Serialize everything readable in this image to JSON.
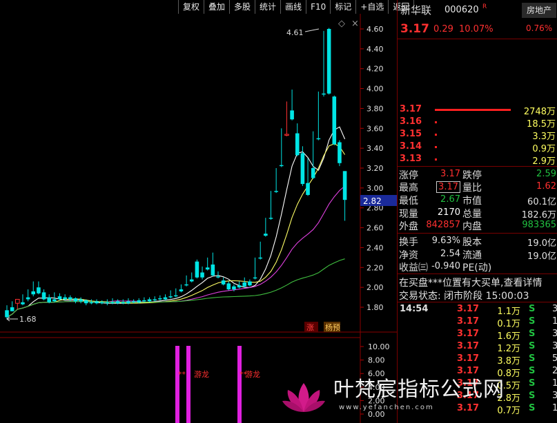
{
  "toolbar": [
    "复权",
    "叠加",
    "多股",
    "统计",
    "画线",
    "F10",
    "标记",
    "+自选",
    "返回"
  ],
  "colors": {
    "up": "#ff3030",
    "down": "#00e5e5",
    "ma5": "#ffffff",
    "ma10": "#ffff66",
    "ma20": "#e040e0",
    "ma60": "#40c040",
    "accent": "#ff3030",
    "green": "#20c040"
  },
  "stock": {
    "name": "新华联",
    "code": "000620",
    "badge": "R",
    "price": "3.17",
    "change": "0.29",
    "change_pct": "10.07%",
    "sector": "房地产",
    "sector_pct": "0.76%"
  },
  "orderbook": [
    {
      "price": "3.17",
      "vol": "2748万",
      "level": 1.0
    },
    {
      "price": "3.16",
      "vol": "18.5万",
      "level": 0.01
    },
    {
      "price": "3.15",
      "vol": "3.3万",
      "level": 0.01
    },
    {
      "price": "3.14",
      "vol": "0.9万",
      "level": 0.01
    },
    {
      "price": "3.13",
      "vol": "2.9万",
      "level": 0.01
    }
  ],
  "quote": {
    "zhangting_label": "涨停",
    "zhangting": "3.17",
    "dieting_label": "跌停",
    "dieting": "2.59",
    "zuigao_label": "最高",
    "zuigao": "3.17",
    "liangbi_label": "量比",
    "liangbi": "1.62",
    "zuidi_label": "最低",
    "zuidi": "2.67",
    "shizhi_label": "市值",
    "shizhi": "60.1亿",
    "xianliang_label": "现量",
    "xianliang": "2170",
    "zongliang_label": "总量",
    "zongliang": "182.6万",
    "waipan_label": "外盘",
    "waipan": "842857",
    "neipan_label": "内盘",
    "neipan": "983365",
    "huanshou_label": "换手",
    "huanshou": "9.63%",
    "guben_label": "股本",
    "guben": "19.0亿",
    "jingzi_label": "净资",
    "jingzi": "2.54",
    "liutong_label": "流通",
    "liutong": "19.0亿",
    "shouyi_label": "收益㈢",
    "shouyi": "-0.940",
    "pe_label": "PE(动)",
    "pe": ""
  },
  "notice": "在买盘***位置有大买单,查看详情",
  "trade_status": "交易状态: 闭市阶段 15:00:03",
  "ticks": [
    {
      "time": "14:54",
      "price": "3.17",
      "vol": "1.1万",
      "side": "S",
      "n": "3"
    },
    {
      "time": "",
      "price": "3.17",
      "vol": "0.1万",
      "side": "S",
      "n": "1"
    },
    {
      "time": "",
      "price": "3.17",
      "vol": "1.6万",
      "side": "S",
      "n": "3"
    },
    {
      "time": "",
      "price": "3.17",
      "vol": "1.2万",
      "side": "S",
      "n": "3"
    },
    {
      "time": "",
      "price": "3.17",
      "vol": "3.8万",
      "side": "S",
      "n": "5"
    },
    {
      "time": "",
      "price": "3.17",
      "vol": "0.8万",
      "side": "S",
      "n": "2"
    },
    {
      "time": "",
      "price": "3.17",
      "vol": "0.5万",
      "side": "S",
      "n": "1"
    },
    {
      "time": "",
      "price": "3.17",
      "vol": "2.8万",
      "side": "S",
      "n": "3"
    },
    {
      "time": "",
      "price": "3.17",
      "vol": "0.7万",
      "side": "S",
      "n": "1"
    }
  ],
  "chart_main": {
    "y_ticks": [
      "4.60",
      "4.40",
      "4.20",
      "4.00",
      "3.80",
      "3.60",
      "3.40",
      "3.20",
      "3.00",
      "2.80",
      "2.60",
      "2.40",
      "2.20",
      "2.00",
      "1.80"
    ],
    "cursor_price": "2.82",
    "high_label": "4.61",
    "low_label": "1.68",
    "zhang_badge": "涨",
    "tag_badge": "杨预",
    "diamond": "◇",
    "close_x": "×"
  },
  "chart_sub": {
    "y_ticks": [
      "10.00",
      "8.00",
      "6.00",
      "4.00",
      "2.00",
      "0.00"
    ],
    "signal_label": "游龙",
    "signal_marker": "**"
  },
  "chart_data": {
    "type": "candlestick",
    "ylim": [
      1.7,
      4.66
    ],
    "candles": [
      [
        1.77,
        1.82,
        1.7,
        1.68
      ],
      [
        1.8,
        1.86,
        1.76,
        1.76
      ],
      [
        1.84,
        1.84,
        1.88,
        1.78
      ],
      [
        1.85,
        1.93,
        1.83,
        1.82
      ],
      [
        1.9,
        1.98,
        1.88,
        1.86
      ],
      [
        1.96,
        2.06,
        1.93,
        1.91
      ],
      [
        2.0,
        2.06,
        1.94,
        1.93
      ],
      [
        1.95,
        1.98,
        1.88,
        1.87
      ],
      [
        1.9,
        1.93,
        1.85,
        1.84
      ],
      [
        1.88,
        1.95,
        1.86,
        1.85
      ],
      [
        1.91,
        1.94,
        1.88,
        1.87
      ],
      [
        1.9,
        1.93,
        1.88,
        1.87
      ],
      [
        1.9,
        1.92,
        1.88,
        1.86
      ],
      [
        1.89,
        1.9,
        1.86,
        1.84
      ],
      [
        1.88,
        1.9,
        1.86,
        1.84
      ],
      [
        1.87,
        1.88,
        1.84,
        1.82
      ],
      [
        1.85,
        1.88,
        1.84,
        1.83
      ],
      [
        1.86,
        1.88,
        1.84,
        1.83
      ],
      [
        1.85,
        1.87,
        1.84,
        1.83
      ],
      [
        1.85,
        1.88,
        1.84,
        1.82
      ],
      [
        1.85,
        1.89,
        1.84,
        1.83
      ],
      [
        1.86,
        1.88,
        1.84,
        1.83
      ],
      [
        1.85,
        1.88,
        1.84,
        1.83
      ],
      [
        1.86,
        1.89,
        1.84,
        1.83
      ],
      [
        1.86,
        1.88,
        1.85,
        1.84
      ],
      [
        1.87,
        1.89,
        1.85,
        1.84
      ],
      [
        1.87,
        1.9,
        1.86,
        1.85
      ],
      [
        1.88,
        1.9,
        1.86,
        1.85
      ],
      [
        1.88,
        1.91,
        1.87,
        1.86
      ],
      [
        1.89,
        1.92,
        1.88,
        1.87
      ],
      [
        1.9,
        1.93,
        1.88,
        1.87
      ],
      [
        1.91,
        1.97,
        1.9,
        1.89
      ],
      [
        1.92,
        1.99,
        1.91,
        1.9
      ],
      [
        1.98,
        2.03,
        1.96,
        1.95
      ],
      [
        2.03,
        2.12,
        2.02,
        2.01
      ],
      [
        2.08,
        2.15,
        2.06,
        2.05
      ],
      [
        2.26,
        2.28,
        2.1,
        2.09
      ],
      [
        2.15,
        2.21,
        2.1,
        2.08
      ],
      [
        2.2,
        2.3,
        2.18,
        2.17
      ],
      [
        2.23,
        2.35,
        2.12,
        2.11
      ],
      [
        2.11,
        2.16,
        2.1,
        2.09
      ],
      [
        2.07,
        2.1,
        2.03,
        2.02
      ],
      [
        2.04,
        2.06,
        1.98,
        1.97
      ],
      [
        2.01,
        2.03,
        1.98,
        1.96
      ],
      [
        2.02,
        2.06,
        2.0,
        1.99
      ],
      [
        2.05,
        2.1,
        2.01,
        2.0
      ],
      [
        2.06,
        2.08,
        2.02,
        2.01
      ],
      [
        2.1,
        2.3,
        2.09,
        2.08
      ],
      [
        2.3,
        2.46,
        2.29,
        2.28
      ],
      [
        2.54,
        2.7,
        2.52,
        2.51
      ],
      [
        2.7,
        2.97,
        2.69,
        2.68
      ],
      [
        2.97,
        3.2,
        2.96,
        2.95
      ],
      [
        3.23,
        3.6,
        3.22,
        3.21
      ],
      [
        3.53,
        3.87,
        3.54,
        3.52
      ],
      [
        3.78,
        3.99,
        3.69,
        3.68
      ],
      [
        3.55,
        3.65,
        3.33,
        3.32
      ],
      [
        3.35,
        3.42,
        3.04,
        3.02
      ],
      [
        3.05,
        3.3,
        2.93,
        2.92
      ],
      [
        3.2,
        3.57,
        3.1,
        3.09
      ],
      [
        3.5,
        3.97,
        3.49,
        3.48
      ],
      [
        3.95,
        4.58,
        3.94,
        3.92
      ],
      [
        4.6,
        4.61,
        3.95,
        3.94
      ],
      [
        3.92,
        3.93,
        3.44,
        3.43
      ],
      [
        3.46,
        3.48,
        3.25,
        3.22
      ],
      [
        3.17,
        3.17,
        2.88,
        2.67
      ]
    ]
  }
}
